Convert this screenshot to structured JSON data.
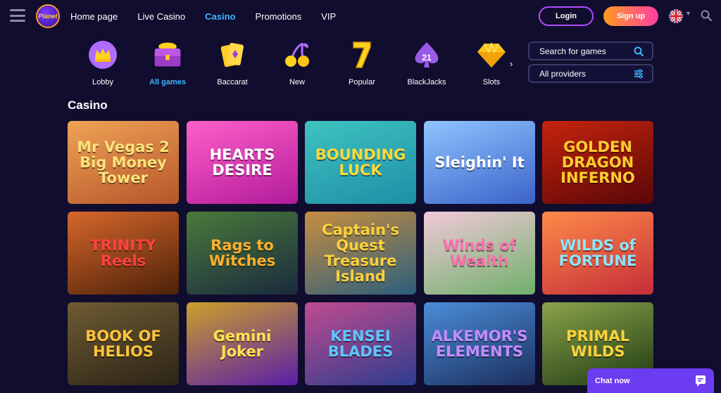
{
  "header": {
    "logo_text": "Planet",
    "nav": [
      "Home page",
      "Live Casino",
      "Casino",
      "Promotions",
      "VIP"
    ],
    "active_nav": "Casino",
    "login_label": "Login",
    "signup_label": "Sign up",
    "language_icon": "uk-flag-icon"
  },
  "categories": [
    {
      "label": "Lobby",
      "icon": "crown-icon",
      "color": "#b06bff"
    },
    {
      "label": "All games",
      "icon": "chest-icon",
      "color": "#b84fd8"
    },
    {
      "label": "Baccarat",
      "icon": "cards-icon",
      "color": "#ffcc2a"
    },
    {
      "label": "New",
      "icon": "cherry-icon",
      "color": "#ffd21f"
    },
    {
      "label": "Popular",
      "icon": "seven-icon",
      "color": "#ffd21f"
    },
    {
      "label": "BlackJacks",
      "icon": "spade-icon",
      "color": "#9a5ae8"
    },
    {
      "label": "Slots",
      "icon": "diamond-icon",
      "color": "#ffc316"
    }
  ],
  "active_category": "All games",
  "search": {
    "placeholder": "Search for games"
  },
  "providers": {
    "label": "All providers"
  },
  "section_title": "Casino",
  "games": [
    {
      "name": "Mr Vegas 2 Big Money Tower",
      "bg1": "#b5552a",
      "bg2": "#f0a356",
      "fg": "#ffe37a"
    },
    {
      "name": "HEARTS DESIRE",
      "bg1": "#b21b9b",
      "bg2": "#ff5fc8",
      "fg": "#ffffff"
    },
    {
      "name": "BOUNDING LUCK",
      "bg1": "#1e8ea6",
      "bg2": "#3ec3c0",
      "fg": "#ffd93b"
    },
    {
      "name": "Sleighin' It",
      "bg1": "#3b63c9",
      "bg2": "#8fc4ff",
      "fg": "#ffffff"
    },
    {
      "name": "GOLDEN DRAGON INFERNO",
      "bg1": "#5a0707",
      "bg2": "#c5240d",
      "fg": "#ffcc2e"
    },
    {
      "name": "TRINITY Reels",
      "bg1": "#4c2108",
      "bg2": "#d7672b",
      "fg": "#ff4141"
    },
    {
      "name": "Rags to Witches",
      "bg1": "#1a2a3e",
      "bg2": "#4a7a3a",
      "fg": "#ffb02c"
    },
    {
      "name": "Captain's Quest Treasure Island",
      "bg1": "#2b5e7c",
      "bg2": "#c78e3f",
      "fg": "#ffd13a"
    },
    {
      "name": "Winds of Wealth",
      "bg1": "#6fb06a",
      "bg2": "#f2c9d9",
      "fg": "#ff6fb0"
    },
    {
      "name": "WILDS of FORTUNE",
      "bg1": "#c42e38",
      "bg2": "#ff8a4a",
      "fg": "#8de4ff"
    },
    {
      "name": "BOOK OF HELIOS",
      "bg1": "#2c2416",
      "bg2": "#6e5b33",
      "fg": "#ffc43a"
    },
    {
      "name": "Gemini Joker",
      "bg1": "#5a1ea8",
      "bg2": "#cc9f2a",
      "fg": "#ffe450"
    },
    {
      "name": "KENSEI BLADES",
      "bg1": "#2d3d8e",
      "bg2": "#c04b8f",
      "fg": "#5cc7ff"
    },
    {
      "name": "ALKEMOR'S ELEMENTS",
      "bg1": "#1b2f5e",
      "bg2": "#4b8dd8",
      "fg": "#c58cff"
    },
    {
      "name": "PRIMAL WILDS",
      "bg1": "#1f3a14",
      "bg2": "#8aa34a",
      "fg": "#ffd23a"
    }
  ],
  "chat": {
    "label": "Chat now"
  }
}
